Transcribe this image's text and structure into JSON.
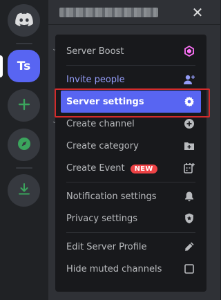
{
  "rail": {
    "server_initials": "Ts"
  },
  "menu": {
    "items": [
      {
        "label": "Server Boost",
        "icon": "boost-gem-icon"
      },
      {
        "label": "Invite people",
        "icon": "add-person-icon"
      },
      {
        "label": "Server settings",
        "icon": "gear-icon"
      },
      {
        "label": "Create channel",
        "icon": "add-circle-icon"
      },
      {
        "label": "Create category",
        "icon": "add-folder-icon"
      },
      {
        "label": "Create Event",
        "icon": "calendar-add-icon",
        "badge": "NEW"
      },
      {
        "label": "Notification settings",
        "icon": "bell-icon"
      },
      {
        "label": "Privacy settings",
        "icon": "shield-icon"
      },
      {
        "label": "Edit Server Profile",
        "icon": "pencil-icon"
      },
      {
        "label": "Hide muted channels",
        "icon": "checkbox-icon"
      }
    ]
  },
  "colors": {
    "accent": "#5865f2",
    "boost": "#ff73fa",
    "invite": "#949cf7",
    "green": "#3ba55d",
    "badge": "#ed4245",
    "highlight_box": "#d22b2b"
  }
}
